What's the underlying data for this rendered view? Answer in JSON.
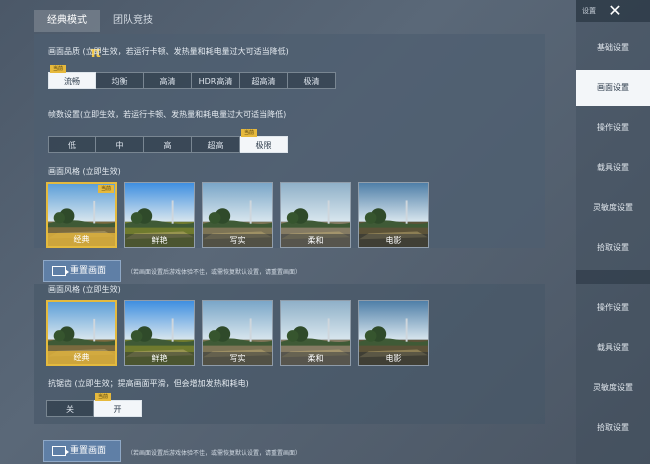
{
  "tabs": [
    {
      "label": "经典模式",
      "active": true
    },
    {
      "label": "团队竞技",
      "active": false
    }
  ],
  "quality": {
    "label": "画面品质 (立即生效，若运行卡顿、发热量和耗电量过大可适当降低)",
    "badge": "当前",
    "options": [
      "流畅",
      "均衡",
      "高清",
      "HDR高清",
      "超高清",
      "极清"
    ],
    "selected": "流畅"
  },
  "fps": {
    "label": "帧数设置(立即生效，若运行卡顿、发热量和耗电量过大可适当降低)",
    "badge": "当前",
    "options": [
      "低",
      "中",
      "高",
      "超高",
      "极限"
    ],
    "selected": "极限"
  },
  "style": {
    "label": "画面风格 (立即生效)",
    "badge": "当前",
    "options": [
      "经典",
      "鲜艳",
      "写实",
      "柔和",
      "电影"
    ],
    "selected": "经典"
  },
  "style2": {
    "label": "画面风格 (立即生效)",
    "options": [
      "经典",
      "鲜艳",
      "写实",
      "柔和",
      "电影"
    ],
    "selected": "经典"
  },
  "antialias": {
    "label": "抗锯齿 (立即生效；提高画面平滑，但会增加发热和耗电)",
    "badge": "当前",
    "options": [
      "关",
      "开"
    ],
    "selected": "开"
  },
  "reset": {
    "label": "重置画面",
    "note": "（若画面设置后游戏体验不佳，或需恢复默认设置，请重置画面）"
  },
  "sidebar": {
    "header": "设置",
    "items": [
      {
        "label": "基础设置",
        "selected": false
      },
      {
        "label": "画面设置",
        "selected": true
      },
      {
        "label": "操作设置",
        "selected": false
      },
      {
        "label": "载具设置",
        "selected": false
      },
      {
        "label": "灵敏度设置",
        "selected": false
      },
      {
        "label": "拾取设置",
        "selected": false
      }
    ],
    "items2": [
      {
        "label": "操作设置"
      },
      {
        "label": "载具设置"
      },
      {
        "label": "灵敏度设置"
      },
      {
        "label": "拾取设置"
      }
    ]
  },
  "icons": {
    "close": "close-icon",
    "reset": "reset-icon",
    "logo": "pi-logo-icon"
  },
  "colors": {
    "accent": "#e4ba3e",
    "button": "#5f7fa6",
    "selected_bg": "#f3f6f9"
  }
}
